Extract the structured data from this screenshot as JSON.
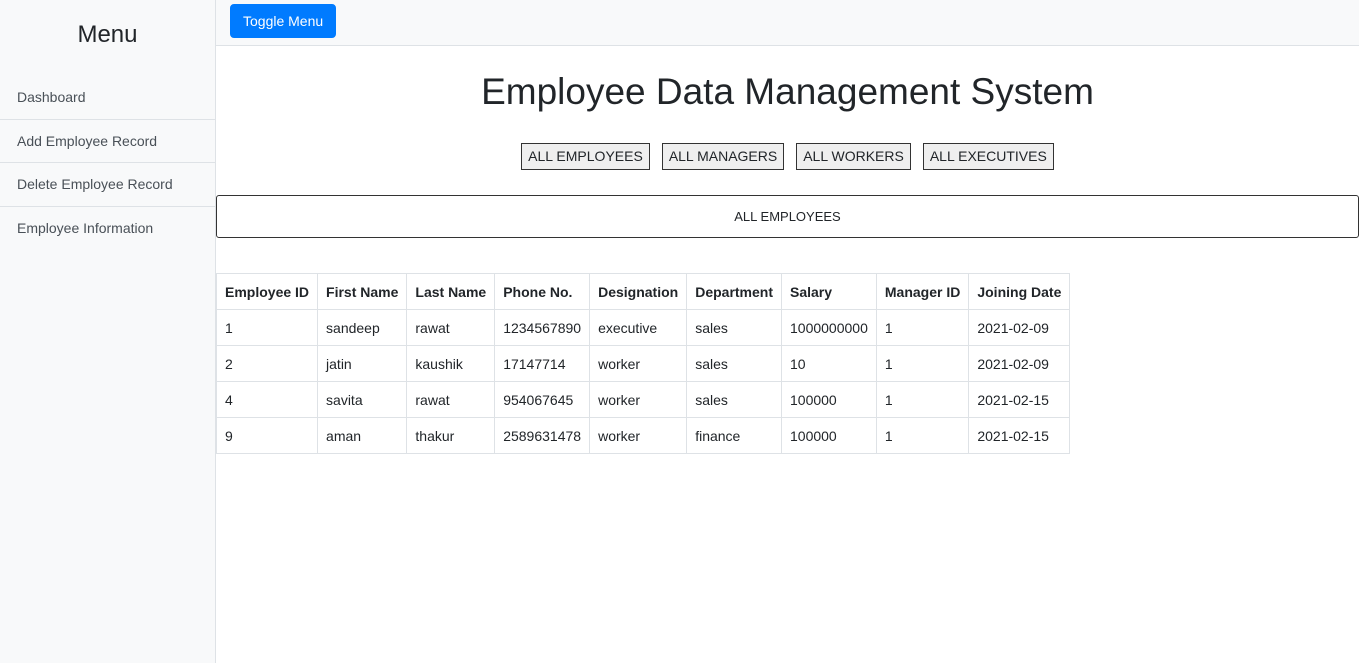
{
  "sidebar": {
    "heading": "Menu",
    "items": [
      {
        "label": "Dashboard"
      },
      {
        "label": "Add Employee Record"
      },
      {
        "label": "Delete Employee Record"
      },
      {
        "label": "Employee Information"
      }
    ]
  },
  "topbar": {
    "toggle_label": "Toggle Menu",
    "toggle_color": "#007bff"
  },
  "main": {
    "title": "Employee Data Management System",
    "filters": [
      {
        "label": "ALL EMPLOYEES"
      },
      {
        "label": "ALL MANAGERS"
      },
      {
        "label": "ALL WORKERS"
      },
      {
        "label": "ALL EXECUTIVES"
      }
    ],
    "section_label": "ALL EMPLOYEES"
  },
  "table": {
    "headers": [
      "Employee ID",
      "First Name",
      "Last Name",
      "Phone No.",
      "Designation",
      "Department",
      "Salary",
      "Manager ID",
      "Joining Date"
    ],
    "rows": [
      [
        "1",
        "sandeep",
        "rawat",
        "1234567890",
        "executive",
        "sales",
        "1000000000",
        "1",
        "2021-02-09"
      ],
      [
        "2",
        "jatin",
        "kaushik",
        "17147714",
        "worker",
        "sales",
        "10",
        "1",
        "2021-02-09"
      ],
      [
        "4",
        "savita",
        "rawat",
        "954067645",
        "worker",
        "sales",
        "100000",
        "1",
        "2021-02-15"
      ],
      [
        "9",
        "aman",
        "thakur",
        "2589631478",
        "worker",
        "finance",
        "100000",
        "1",
        "2021-02-15"
      ]
    ]
  }
}
